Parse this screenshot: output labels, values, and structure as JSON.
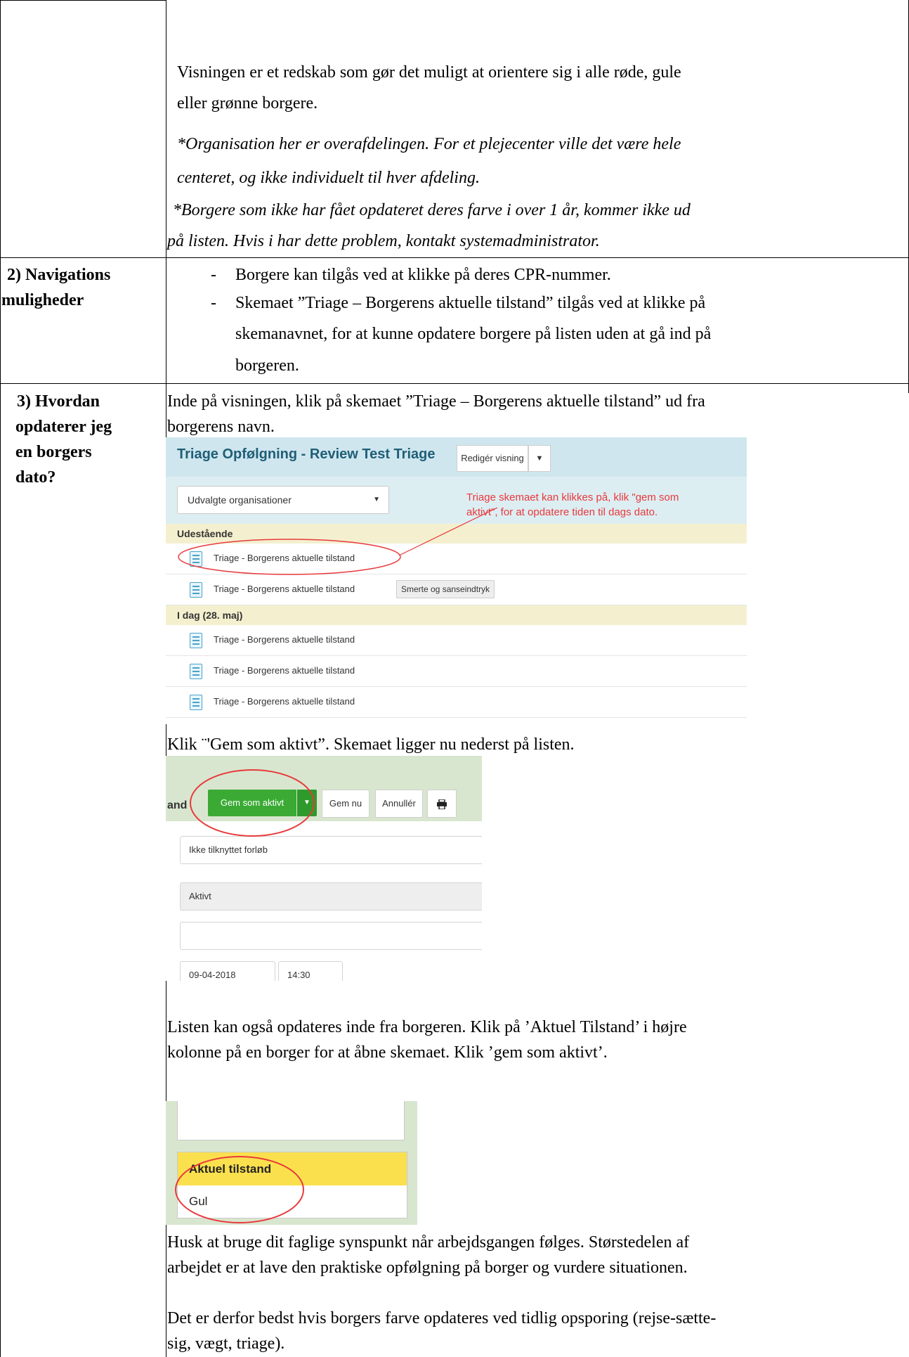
{
  "intro": {
    "line1": "Visningen er et redskab som gør det muligt at orientere sig i alle røde, gule",
    "line2": "eller grønne borgere.",
    "note1_line1": "*Organisation her er overafdelingen. For et plejecenter ville det være hele",
    "note1_line2": "centeret, og ikke individuelt til hver afdeling.",
    "note2_line1": "*Borgere som ikke har fået opdateret deres farve i over 1 år, kommer ikke ud",
    "note2_line2": "på listen. Hvis i har dette problem, kontakt systemadministrator."
  },
  "section2": {
    "heading_line1": "2) Navigations",
    "heading_line2": "muligheder",
    "bullet_marker": "-",
    "bullet1": "Borgere kan tilgås ved at klikke på deres CPR-nummer.",
    "bullet2_line1": "Skemaet ”Triage – Borgerens aktuelle tilstand” tilgås ved at klikke på",
    "bullet2_line2": "skemanavnet, for at kunne opdatere borgere på listen uden at gå ind på",
    "bullet2_line3": "borgeren."
  },
  "section3": {
    "heading_line1": "3) Hvordan",
    "heading_line2": "opdaterer jeg",
    "heading_line3": "en borgers",
    "heading_line4": "dato?",
    "p1_line1": "Inde på visningen, klik på skemaet ”Triage – Borgerens aktuelle tilstand” ud fra",
    "p1_line2": "borgerens navn.",
    "p2": "Klik ¨'Gem som aktivt”. Skemaet ligger nu nederst på listen.",
    "p3_line1": "Listen kan også opdateres inde fra borgeren. Klik på ’Aktuel Tilstand’ i højre",
    "p3_line2": "kolonne på en borger for at åbne skemaet. Klik ’gem som aktivt’.",
    "p4_line1": "Husk at bruge dit faglige synspunkt når arbejdsgangen følges. Størstedelen af",
    "p4_line2": "arbejdet er at lave den praktiske opfølgning på borger og vurdere situationen.",
    "p5_line1": "Det er derfor bedst hvis borgers farve opdateres ved tidlig opsporing (rejse-sætte-",
    "p5_line2": "sig, vægt, triage)."
  },
  "screenshot1": {
    "title": "Triage Opfølgning - Review Test Triage",
    "edit_button": "Redigér visning",
    "filter_select": "Udvalgte organisationer",
    "annotation_line1": "Triage skemaet kan klikkes på, klik \"gem som",
    "annotation_line2": "aktivt\", for at opdatere tiden til dags dato.",
    "group1": "Udestående",
    "row1": "Triage - Borgerens aktuelle tilstand",
    "row2": "Triage - Borgerens aktuelle tilstand",
    "row2_tag": "Smerte og sanseindtryk",
    "group2": "I dag (28. maj)",
    "row3": "Triage - Borgerens aktuelle tilstand",
    "row4": "Triage - Borgerens aktuelle tilstand",
    "row5": "Triage - Borgerens aktuelle tilstand",
    "annotation_color": "#e8393b"
  },
  "screenshot2": {
    "fragment": "and",
    "save_active": "Gem som aktivt",
    "save_now": "Gem nu",
    "cancel": "Annullér",
    "course_field": "Ikke tilknyttet forløb",
    "status_field": "Aktivt",
    "date": "09-04-2018",
    "time": "14:30",
    "accent": "#3aaa35"
  },
  "screenshot3": {
    "header": "Aktuel tilstand",
    "value": "Gul",
    "header_color": "#fbe04e"
  }
}
